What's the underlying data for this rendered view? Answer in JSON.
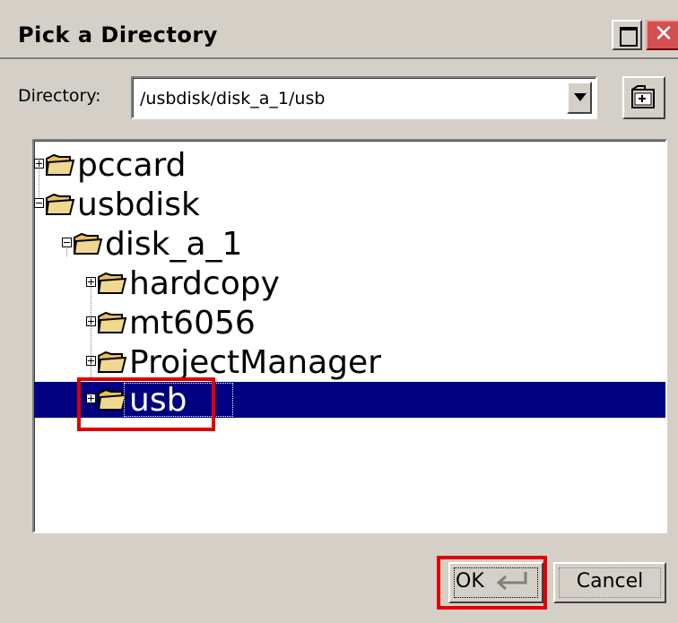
{
  "window": {
    "title": "Pick a Directory",
    "maximize_icon": "maximize-icon",
    "close_icon": "close-icon",
    "close_glyph": "✕"
  },
  "directory": {
    "label": "Directory:",
    "value": "/usbdisk/disk_a_1/usb",
    "dropdown_icon": "chevron-down-icon",
    "new_folder_icon": "new-folder-icon"
  },
  "tree": {
    "items": [
      {
        "label": "pccard",
        "level": 0,
        "expanded": false
      },
      {
        "label": "usbdisk",
        "level": 0,
        "expanded": true
      },
      {
        "label": "disk_a_1",
        "level": 1,
        "expanded": true
      },
      {
        "label": "hardcopy",
        "level": 2,
        "expanded": false
      },
      {
        "label": "mt6056",
        "level": 2,
        "expanded": false
      },
      {
        "label": "ProjectManager",
        "level": 2,
        "expanded": false
      },
      {
        "label": "usb",
        "level": 2,
        "expanded": false,
        "selected": true
      }
    ],
    "selection_color": "#000080",
    "folder_color": "#e8c060"
  },
  "buttons": {
    "ok_label": "OK",
    "ok_icon": "return-icon",
    "cancel_label": "Cancel"
  },
  "highlight_color": "#e00000"
}
